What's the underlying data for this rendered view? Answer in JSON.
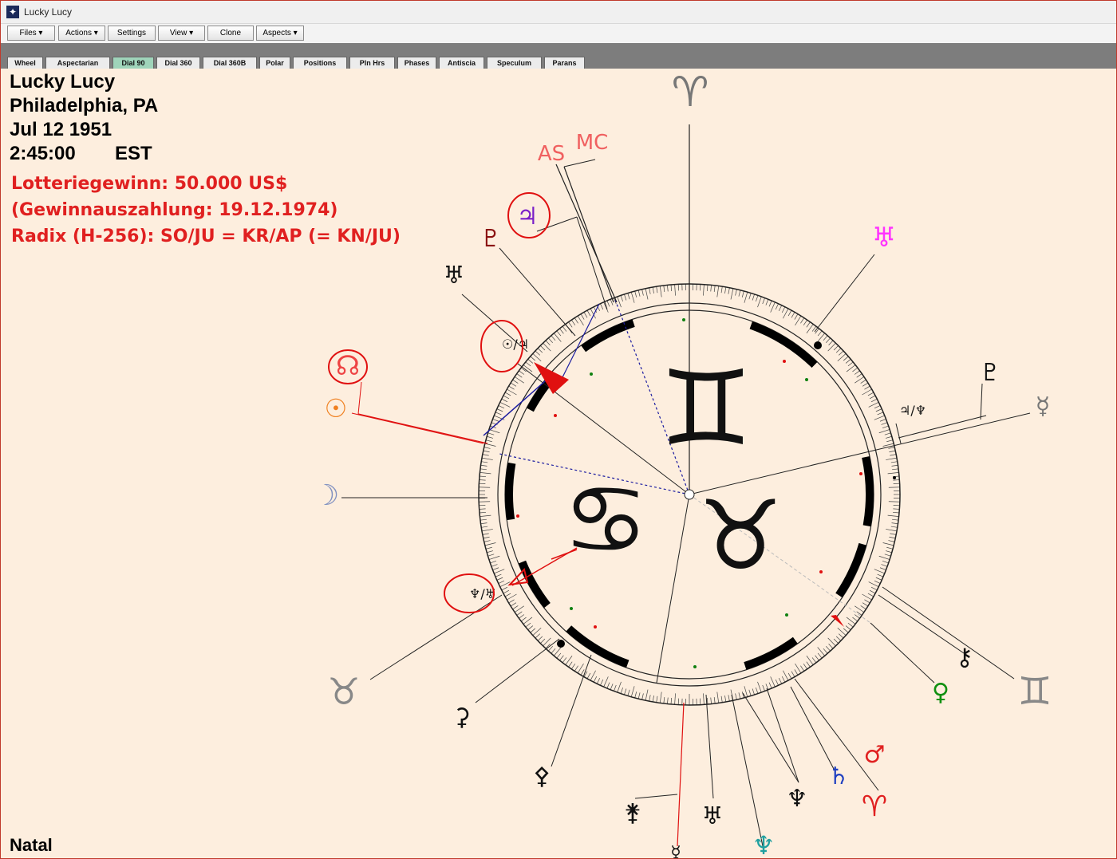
{
  "window": {
    "title": "Lucky Lucy",
    "icon": "star-icon"
  },
  "menu": [
    "Files ▾",
    "Actions ▾",
    "Settings",
    "View ▾",
    "Clone",
    "Aspects ▾"
  ],
  "tabs": [
    {
      "label": "Wheel"
    },
    {
      "label": "Aspectarian"
    },
    {
      "label": "Dial 90",
      "active": true
    },
    {
      "label": "Dial 360"
    },
    {
      "label": "Dial 360B"
    },
    {
      "label": "Polar"
    },
    {
      "label": "Positions"
    },
    {
      "label": "Pln Hrs"
    },
    {
      "label": "Phases"
    },
    {
      "label": "Antiscia"
    },
    {
      "label": "Speculum"
    },
    {
      "label": "Parans"
    }
  ],
  "chart_info": {
    "name": "Lucky Lucy",
    "place": "Philadelphia, PA",
    "date": "Jul 12 1951",
    "time": "2:45:00",
    "zone": "EST"
  },
  "annotations": {
    "line1": "Lotteriegewinn: 50.000 US$",
    "line2": "(Gewinnauszahlung: 19.12.1974)",
    "line3": "Radix (H-256): SO/JU = KR/AP (= KN/JU)"
  },
  "dial": {
    "center_glyphs": [
      "♊",
      "♋",
      "♉"
    ],
    "midpoint_labels": [
      "☉/♃",
      "♃/♆",
      "♆/♅"
    ],
    "planets": [
      {
        "glyph": "♈",
        "color": "#777777",
        "name": "aries-marker"
      },
      {
        "glyph": "MC",
        "color": "#f06060",
        "name": "mc-label"
      },
      {
        "glyph": "AS",
        "color": "#f06060",
        "name": "ascendant-label"
      },
      {
        "glyph": "♃",
        "color": "#7a1fc8",
        "name": "jupiter"
      },
      {
        "glyph": "♇",
        "color": "#8a1010",
        "name": "pluto"
      },
      {
        "glyph": "♅",
        "color": "#ff33ff",
        "name": "uranus"
      },
      {
        "glyph": "♅",
        "color": "#111111",
        "name": "hades"
      },
      {
        "glyph": "☊",
        "color": "#ee4444",
        "name": "north-node"
      },
      {
        "glyph": "☉",
        "color": "#f08020",
        "name": "sun"
      },
      {
        "glyph": "☽",
        "color": "#8090c0",
        "name": "moon"
      },
      {
        "glyph": "♉",
        "color": "#888888",
        "name": "taurus-marker"
      },
      {
        "glyph": "⚳",
        "color": "#111111",
        "name": "vulkanus"
      },
      {
        "glyph": "⚴",
        "color": "#111111",
        "name": "kronos"
      },
      {
        "glyph": "♇",
        "color": "#111111",
        "name": "zeus"
      },
      {
        "glyph": "☿",
        "color": "#777777",
        "name": "mercury"
      },
      {
        "glyph": "⚷",
        "color": "#111111",
        "name": "admetos"
      },
      {
        "glyph": "♀",
        "color": "#109010",
        "name": "venus"
      },
      {
        "glyph": "♊",
        "color": "#888888",
        "name": "gemini-marker"
      },
      {
        "glyph": "♂",
        "color": "#e02020",
        "name": "mars"
      },
      {
        "glyph": "♄",
        "color": "#2040c0",
        "name": "saturn"
      },
      {
        "glyph": "♈",
        "color": "#e02020",
        "name": "aries-point"
      },
      {
        "glyph": "♆",
        "color": "#20a0a0",
        "name": "neptune"
      },
      {
        "glyph": "♅",
        "color": "#111111",
        "name": "apollon"
      },
      {
        "glyph": "♆",
        "color": "#111111",
        "name": "poseidon"
      },
      {
        "glyph": "⚵",
        "color": "#111111",
        "name": "cupido"
      },
      {
        "glyph": "☿",
        "color": "#111111",
        "name": "midpoint-planet"
      }
    ]
  },
  "status": "Natal"
}
